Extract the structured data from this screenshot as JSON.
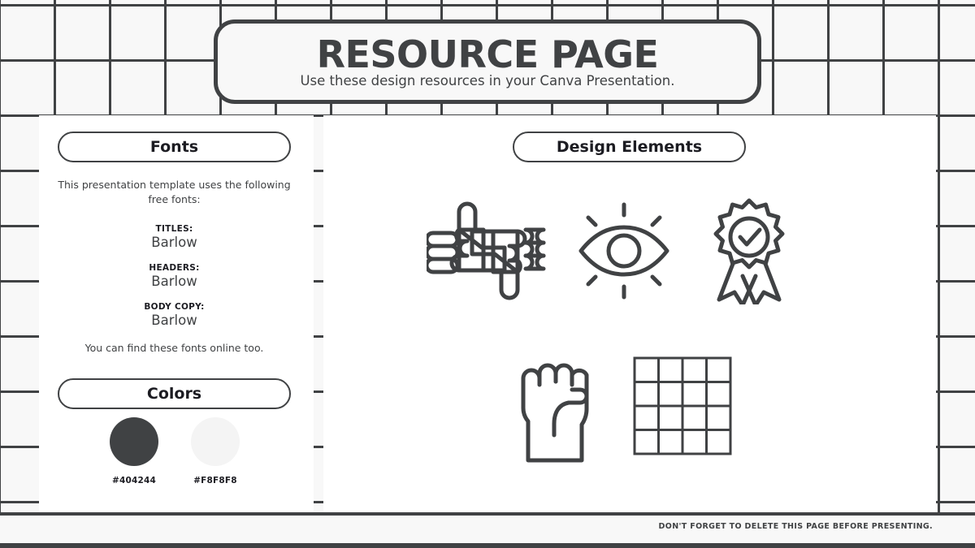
{
  "header": {
    "title": "RESOURCE PAGE",
    "subtitle": "Use these design resources in your Canva Presentation."
  },
  "fonts_panel": {
    "heading": "Fonts",
    "intro": "This presentation template uses the following free fonts:",
    "entries": [
      {
        "role": "TITLES:",
        "name": "Barlow"
      },
      {
        "role": "HEADERS:",
        "name": "Barlow"
      },
      {
        "role": "BODY COPY:",
        "name": "Barlow"
      }
    ],
    "outro": "You can find these fonts online too."
  },
  "colors_panel": {
    "heading": "Colors",
    "swatches": [
      {
        "hex": "#404244"
      },
      {
        "hex": "#F8F8F8"
      }
    ]
  },
  "design_elements_panel": {
    "heading": "Design Elements",
    "icons": [
      {
        "name": "thumbs-up-down-icon"
      },
      {
        "name": "eye-rays-icon"
      },
      {
        "name": "award-ribbon-check-icon"
      },
      {
        "name": "raised-fist-icon"
      },
      {
        "name": "grid-4x4-icon"
      }
    ]
  },
  "footer": {
    "note": "DON'T FORGET TO DELETE THIS PAGE BEFORE PRESENTING."
  },
  "theme": {
    "ink": "#404244",
    "paper": "#F8F8F8",
    "card": "#FFFFFF"
  }
}
